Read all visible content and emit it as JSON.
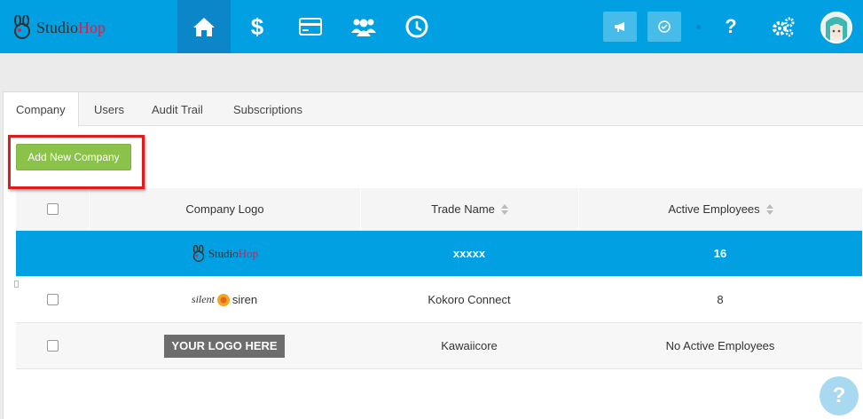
{
  "brand": {
    "name_part1": "Studio",
    "name_part2": "Hop"
  },
  "nav": [
    {
      "icon": "home-icon",
      "active": true
    },
    {
      "icon": "dollar-icon",
      "label": "$"
    },
    {
      "icon": "credit-card-icon"
    },
    {
      "icon": "users-icon"
    },
    {
      "icon": "clock-icon"
    }
  ],
  "header_right": {
    "announcements_icon": "megaphone-icon",
    "tasks_icon": "check-circle-icon",
    "help_label": "?",
    "settings_icon": "gears-icon",
    "avatar_icon": "user-avatar"
  },
  "tabs": [
    "Company",
    "Users",
    "Audit Trail",
    "Subscriptions"
  ],
  "toolbar": {
    "add_label": "Add New Company"
  },
  "table": {
    "headers": [
      "Company Logo",
      "Trade Name",
      "Active Employees"
    ],
    "rows": [
      {
        "logo_part1": "Studio",
        "logo_part2": "Hop",
        "trade_name": "xxxxx",
        "active": "16",
        "selected": true
      },
      {
        "logo_part1": "silent",
        "logo_part2": "siren",
        "trade_name": "Kokoro Connect",
        "active": "8"
      },
      {
        "logo_text": "YOUR LOGO HERE",
        "trade_name": "Kawaiicore",
        "active": "No Active Employees"
      }
    ]
  },
  "colors": {
    "topbar": "#00a0e3",
    "nav_active": "#0b86c9",
    "add_button": "#8bc34a",
    "highlight": "#e01b1b",
    "selected_row": "#00a0e3"
  }
}
